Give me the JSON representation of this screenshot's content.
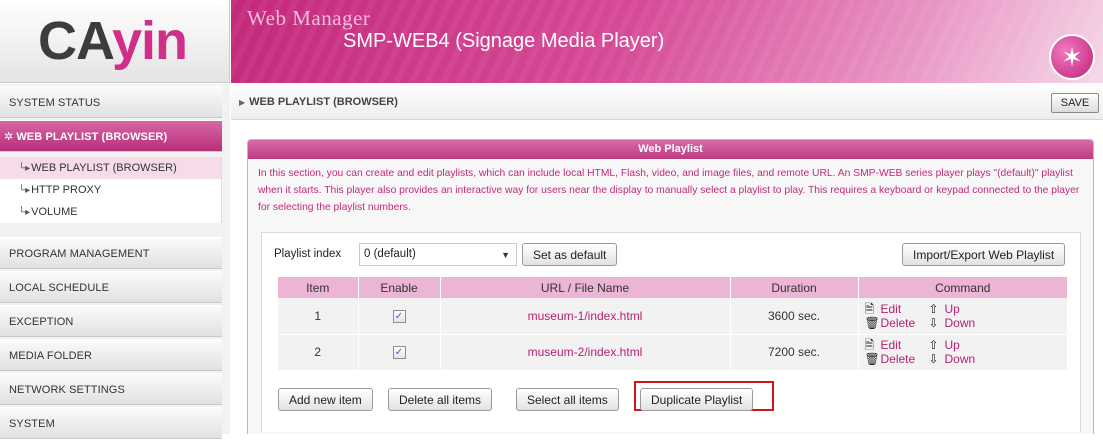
{
  "logo": {
    "text_dark": "CA",
    "text_pink": "yin"
  },
  "header": {
    "title": "Web Manager",
    "subtitle": "SMP-WEB4 (Signage Media Player)",
    "badge_icon": "magic-wand-icon"
  },
  "sidebar": {
    "items": [
      {
        "label": "SYSTEM STATUS"
      },
      {
        "label": "WEB PLAYLIST (BROWSER)"
      },
      {
        "label": "PROGRAM MANAGEMENT"
      },
      {
        "label": "LOCAL SCHEDULE"
      },
      {
        "label": "EXCEPTION"
      },
      {
        "label": "MEDIA FOLDER"
      },
      {
        "label": "NETWORK SETTINGS"
      },
      {
        "label": "SYSTEM"
      }
    ],
    "sub_items": [
      {
        "label": "WEB PLAYLIST (BROWSER)"
      },
      {
        "label": "HTTP PROXY"
      },
      {
        "label": "VOLUME"
      }
    ]
  },
  "breadcrumb": {
    "label": "WEB PLAYLIST (BROWSER)"
  },
  "toolbar": {
    "save_label": "SAVE"
  },
  "panel": {
    "title": "Web Playlist",
    "description": "In this section, you can create and edit playlists, which can include local HTML, Flash, video, and image files, and remote URL. An SMP-WEB series player plays \"(default)\" playlist when it starts. This player also provides an interactive way for users near the display to manually select a playlist to play. This requires a keyboard or keypad connected to the player for selecting the playlist numbers."
  },
  "playlist": {
    "index_label": "Playlist index",
    "selected": "0 (default)",
    "set_default_label": "Set as default",
    "import_export_label": "Import/Export Web Playlist"
  },
  "table": {
    "headers": {
      "item": "Item",
      "enable": "Enable",
      "url": "URL / File Name",
      "duration": "Duration",
      "command": "Command"
    },
    "rows": [
      {
        "item": "1",
        "enabled": true,
        "url": "museum-1/index.html",
        "duration": "3600 sec.",
        "edit": "Edit",
        "delete": "Delete",
        "up": "Up",
        "down": "Down"
      },
      {
        "item": "2",
        "enabled": true,
        "url": "museum-2/index.html",
        "duration": "7200 sec.",
        "edit": "Edit",
        "delete": "Delete",
        "up": "Up",
        "down": "Down"
      }
    ]
  },
  "actions": {
    "add_label": "Add new item",
    "delete_all_label": "Delete all items",
    "select_all_label": "Select all items",
    "duplicate_label": "Duplicate Playlist"
  },
  "colors": {
    "brand_pink": "#cf2f86",
    "header_pink": "#c4287a",
    "highlight_red": "#d0141b"
  }
}
